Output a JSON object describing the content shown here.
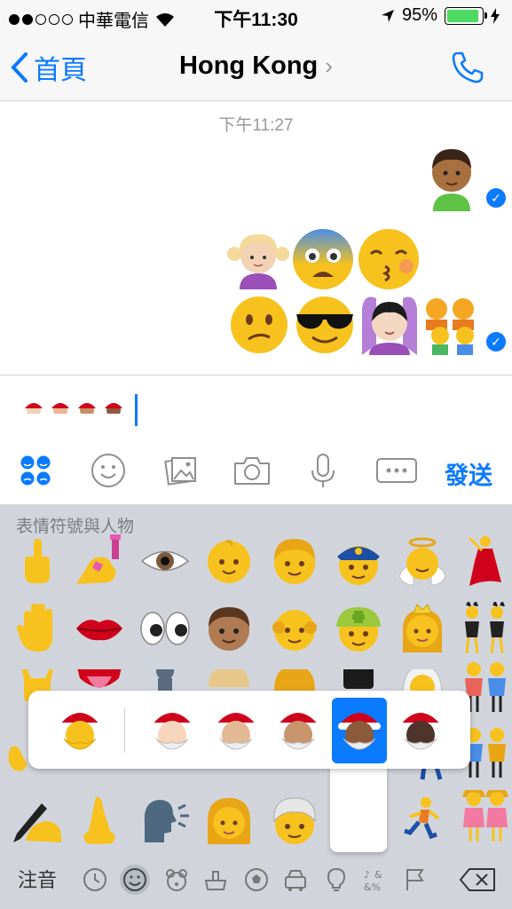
{
  "status": {
    "carrier": "中華電信",
    "time": "下午11:30",
    "battery": "95%"
  },
  "nav": {
    "back_label": "首頁",
    "title": "Hong Kong"
  },
  "chat": {
    "timestamp": "下午11:27"
  },
  "toolbar": {
    "send_label": "發送"
  },
  "keyboard": {
    "section_label": "表情符號與人物",
    "input_mode": "注音"
  },
  "colors": {
    "accent": "#0a7aff",
    "emoji_yellow": "#f7c21d",
    "keyboard_bg": "#d1d5db"
  }
}
